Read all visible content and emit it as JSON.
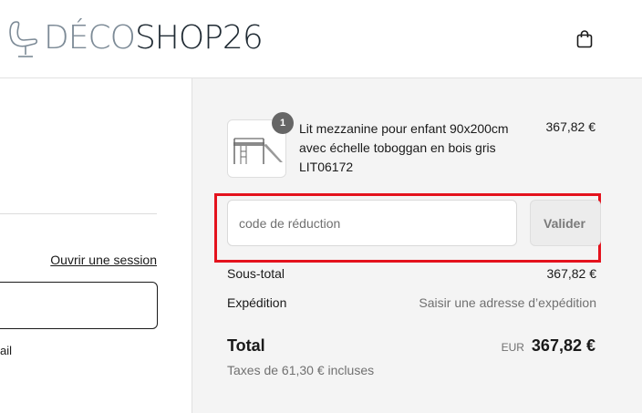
{
  "header": {
    "logo": {
      "part1": "DÉCO",
      "part2": "SHOP26"
    },
    "cart_icon": "shopping-bag-icon"
  },
  "left_panel": {
    "login_link": "Ouvrir une session",
    "email_fragment": "ail"
  },
  "order_summary": {
    "product": {
      "name": "Lit mezzanine pour enfant 90x200cm avec échelle toboggan en bois gris",
      "sku": "LIT06172",
      "price": "367,82 €",
      "quantity": "1"
    },
    "discount": {
      "placeholder": "code de réduction",
      "value": "",
      "button": "Valider"
    },
    "subtotal": {
      "label": "Sous-total",
      "value": "367,82 €"
    },
    "shipping": {
      "label": "Expédition",
      "value": "Saisir une adresse d’expédition"
    },
    "total": {
      "label": "Total",
      "currency": "EUR",
      "value": "367,82 €"
    },
    "taxes": "Taxes de 61,30 € incluses"
  },
  "colors": {
    "highlight_box": "#e4121d",
    "summary_bg": "#f4f4f4",
    "logo_light": "#7c8a96",
    "logo_dark": "#1f2a33"
  }
}
